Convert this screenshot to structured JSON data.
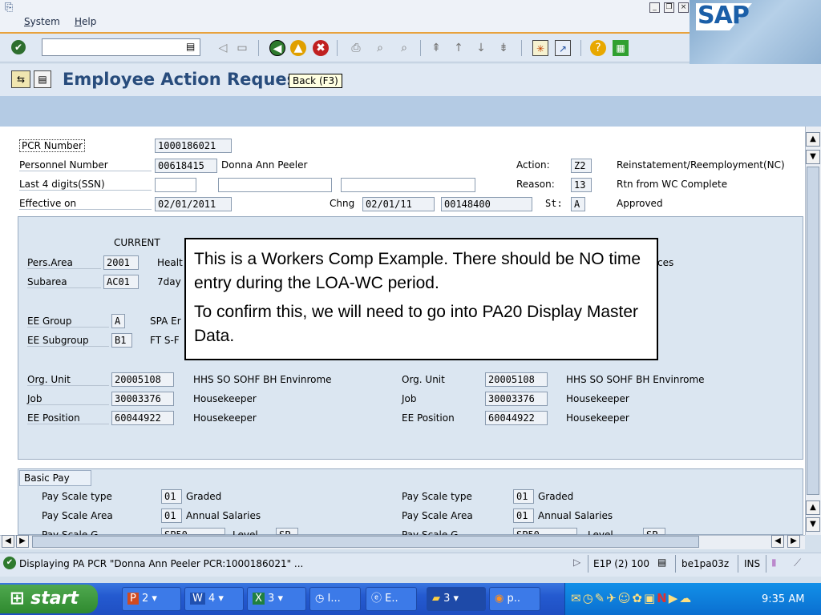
{
  "menu": {
    "items": [
      {
        "label": "System",
        "underline": "S",
        "rest": "ystem"
      },
      {
        "label": "Help",
        "underline": "H",
        "rest": "elp"
      }
    ]
  },
  "toolbar": {
    "icons": [
      "enter-icon",
      "back-icon",
      "exit-icon",
      "cancel-icon",
      "print-icon",
      "find-icon",
      "find-next-icon",
      "first-page-icon",
      "previous-page-icon",
      "next-page-icon",
      "last-page-icon",
      "create-session-icon",
      "shortcut-icon",
      "help-icon",
      "layout-icon"
    ]
  },
  "titlebar": {
    "title": "Employee Action Reques",
    "tooltip": "Back   (F3)"
  },
  "header": {
    "pcr_label": "PCR Number",
    "pcr_value": "1000186021",
    "pernr_label": "Personnel Number",
    "pernr_value": "00618415",
    "name": "Donna Ann Peeler",
    "action_label": "Action:",
    "action_code": "Z2",
    "action_text": "Reinstatement/Reemployment(NC)",
    "ssn_label": "Last 4 digits(SSN)",
    "reason_label": "Reason:",
    "reason_code": "13",
    "reason_text": "Rtn from WC Complete",
    "eff_label": "Effective on",
    "eff_value": "02/01/2011",
    "chng_label": "Chng",
    "chng_date": "02/01/11",
    "chng_user": "00148400",
    "st_label": "St:",
    "st_code": "A",
    "st_text": "Approved"
  },
  "current": {
    "heading": "CURRENT",
    "pers_area_label": "Pers.Area",
    "pers_area": "2001",
    "pers_area_text": "Healt",
    "subarea_label": "Subarea",
    "subarea": "AC01",
    "subarea_text": "7day",
    "ee_group_label": "EE Group",
    "ee_group": "A",
    "ee_group_text": "SPA Er",
    "ee_subgroup_label": "EE Subgroup",
    "ee_subgroup": "B1",
    "ee_subgroup_text": "FT S-F",
    "right_fragment": "ces",
    "org_label": "Org. Unit",
    "org": "20005108",
    "org_text": "HHS SO SOHF BH  Envinrome",
    "job_label": "Job",
    "job": "30003376",
    "job_text": "Housekeeper",
    "pos_label": "EE Position",
    "pos": "60044922",
    "pos_text": "Housekeeper"
  },
  "proposed": {
    "org_label": "Org. Unit",
    "org": "20005108",
    "org_text": "HHS SO SOHF BH  Envinrome",
    "job_label": "Job",
    "job": "30003376",
    "job_text": "Housekeeper",
    "pos_label": "EE Position",
    "pos": "60044922",
    "pos_text": "Housekeeper"
  },
  "basic_pay": {
    "tab": "Basic Pay",
    "left": {
      "type_label": "Pay Scale type",
      "type": "01",
      "type_text": "Graded",
      "area_label": "Pay Scale Area",
      "area": "01",
      "area_text": "Annual Salaries",
      "group_label": "Pay Scale G",
      "group": "SP50",
      "level_label": "Level",
      "level": "SP"
    },
    "right": {
      "type_label": "Pay Scale type",
      "type": "01",
      "type_text": "Graded",
      "area_label": "Pay Scale Area",
      "area": "01",
      "area_text": "Annual Salaries",
      "group_label": "Pay Scale G",
      "group": "SP50",
      "level_label": "Level",
      "level": "SP"
    }
  },
  "popup": {
    "line1": "This is a Workers Comp Example.  There should be NO time entry during the LOA-WC period.",
    "line2": "To confirm this, we will need to go into PA20 Display Master Data."
  },
  "statusbar": {
    "message": "Displaying PA PCR \"Donna Ann Peeler PCR:1000186021\" ...",
    "system": "E1P (2) 100",
    "server": "be1pa03z",
    "mode": "INS"
  },
  "taskbar": {
    "start": "start",
    "tasks": [
      {
        "label": "2",
        "icon": "powerpoint-icon"
      },
      {
        "label": "4",
        "icon": "word-icon"
      },
      {
        "label": "3",
        "icon": "excel-icon"
      },
      {
        "label": "I...",
        "icon": "outlook-icon"
      },
      {
        "label": "E..",
        "icon": "ie-icon"
      },
      {
        "label": "3",
        "icon": "folder-icon"
      },
      {
        "label": "p..",
        "icon": "firefox-icon"
      }
    ],
    "clock": "9:35 AM"
  }
}
